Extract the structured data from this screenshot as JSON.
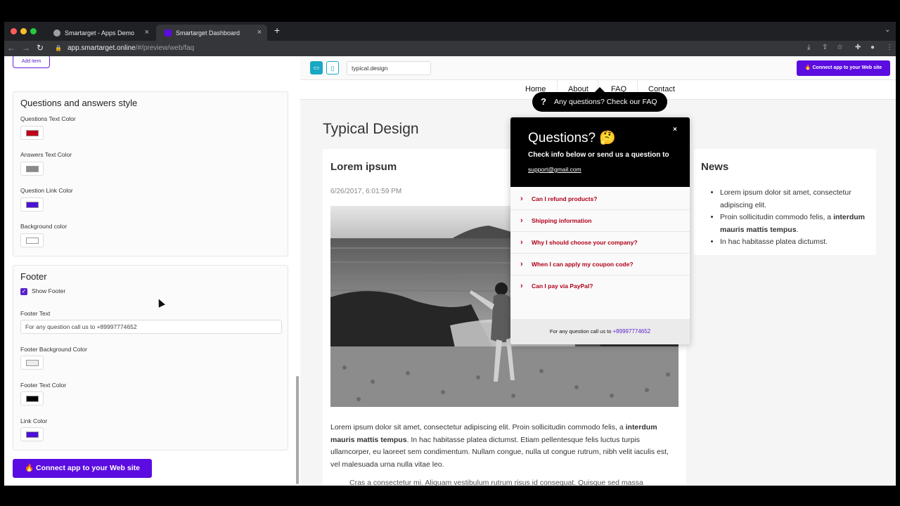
{
  "browser": {
    "tabs": [
      {
        "title": "Smartarget - Apps Demo"
      },
      {
        "title": "Smartarget Dashboard"
      }
    ],
    "new_tab_symbol": "+",
    "url_host": "app.smartarget.online",
    "url_path": "/#/preview/web/faq"
  },
  "settings": {
    "add_item_label": "Add item",
    "qa_style": {
      "title": "Questions and answers style",
      "fields": [
        {
          "label": "Questions Text Color",
          "color": "#c00018"
        },
        {
          "label": "Answers Text Color",
          "color": "#8a8a8a"
        },
        {
          "label": "Question Link Color",
          "color": "#4a12d6"
        },
        {
          "label": "Background color",
          "color": "#ffffff"
        }
      ]
    },
    "footer": {
      "title": "Footer",
      "show_footer_label": "Show Footer",
      "show_footer_checked": true,
      "footer_text_label": "Footer Text",
      "footer_text_value": "For any question call us to +89997774652",
      "color_fields": [
        {
          "label": "Footer Background Color",
          "color": "#ebebeb"
        },
        {
          "label": "Footer Text Color",
          "color": "#000000"
        },
        {
          "label": "Link Color",
          "color": "#4a12d6"
        }
      ]
    },
    "connect_button_label": "🔥 Connect app to your Web site"
  },
  "preview": {
    "domain_value": "typical.design",
    "connect_button_label": "🔥 Connect app to your Web site",
    "nav": [
      "Home",
      "About",
      "FAQ",
      "Contact"
    ],
    "site_title": "Typical Design",
    "article": {
      "title": "Lorem ipsum",
      "date": "6/26/2017, 6:01:59 PM",
      "body_start": "Lorem ipsum dolor sit amet, consectetur adipiscing elit. Proin sollicitudin commodo felis, a ",
      "body_bold": "interdum mauris mattis tempus",
      "body_end": ". In hac habitasse platea dictumst. Etiam pellentesque felis luctus turpis ullamcorper, eu laoreet sem condimentum. Nullam congue, nulla ut congue rutrum, nibh velit iaculis est, vel malesuada urna nulla vitae leo.",
      "body_cut": "Cras a consectetur mi. Aliquam vestibulum rutrum risus id consequat. Quisque sed massa"
    },
    "news": {
      "title": "News",
      "items": [
        {
          "text": "Lorem ipsum dolor sit amet, consectetur adipiscing elit.",
          "bold": ""
        },
        {
          "text": "Proin sollicitudin commodo felis, a ",
          "bold": "interdum mauris mattis tempus",
          "after": "."
        },
        {
          "text": "In hac habitasse platea dictumst.",
          "bold": ""
        }
      ]
    },
    "faq_trigger": {
      "icon": "?",
      "label": "Any questions? Check our FAQ"
    },
    "faq_popup": {
      "title": "Questions? 🤔",
      "close_symbol": "×",
      "subtitle": "Check info below or send us a question to",
      "email": "support@gmail.com",
      "questions": [
        "Can I refund products?",
        "Shipping information",
        "Why I should choose your company?",
        "When I can apply my coupon code?",
        "Can I pay via PayPal?"
      ],
      "footer_text": "For any question call us to ",
      "footer_link": "+89997774652"
    }
  }
}
